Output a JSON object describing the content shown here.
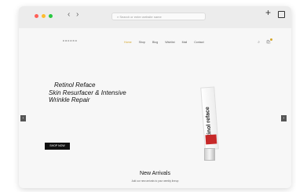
{
  "browser": {
    "url_placeholder": "Search or enter website name",
    "back_icon": "chevron-left-icon",
    "forward_icon": "chevron-right-icon",
    "new_tab_icon": "plus-icon",
    "tabs_icon": "tabs-icon",
    "traffic_lights": [
      "#ff5f57",
      "#febc2e",
      "#28c840"
    ]
  },
  "site": {
    "logo": "cocoxo",
    "menu": [
      "Home",
      "Shop",
      "Blog",
      "Wishlist",
      "Mail",
      "Contact"
    ],
    "active_color": "#d4a72c"
  },
  "hero": {
    "line1": "Retinol Reface",
    "line2": "Skin Resurfacer & Intensive",
    "line3": "Wrinkle Repair",
    "cta": "SHOP NOW",
    "product_label": "retinol reface"
  },
  "carousel": {
    "prev_icon": "chevron-left-icon",
    "next_icon": "chevron-right-icon"
  },
  "section": {
    "title": "New Arrivals",
    "subtitle": "Add our new arrivals to your weekly lineup"
  }
}
